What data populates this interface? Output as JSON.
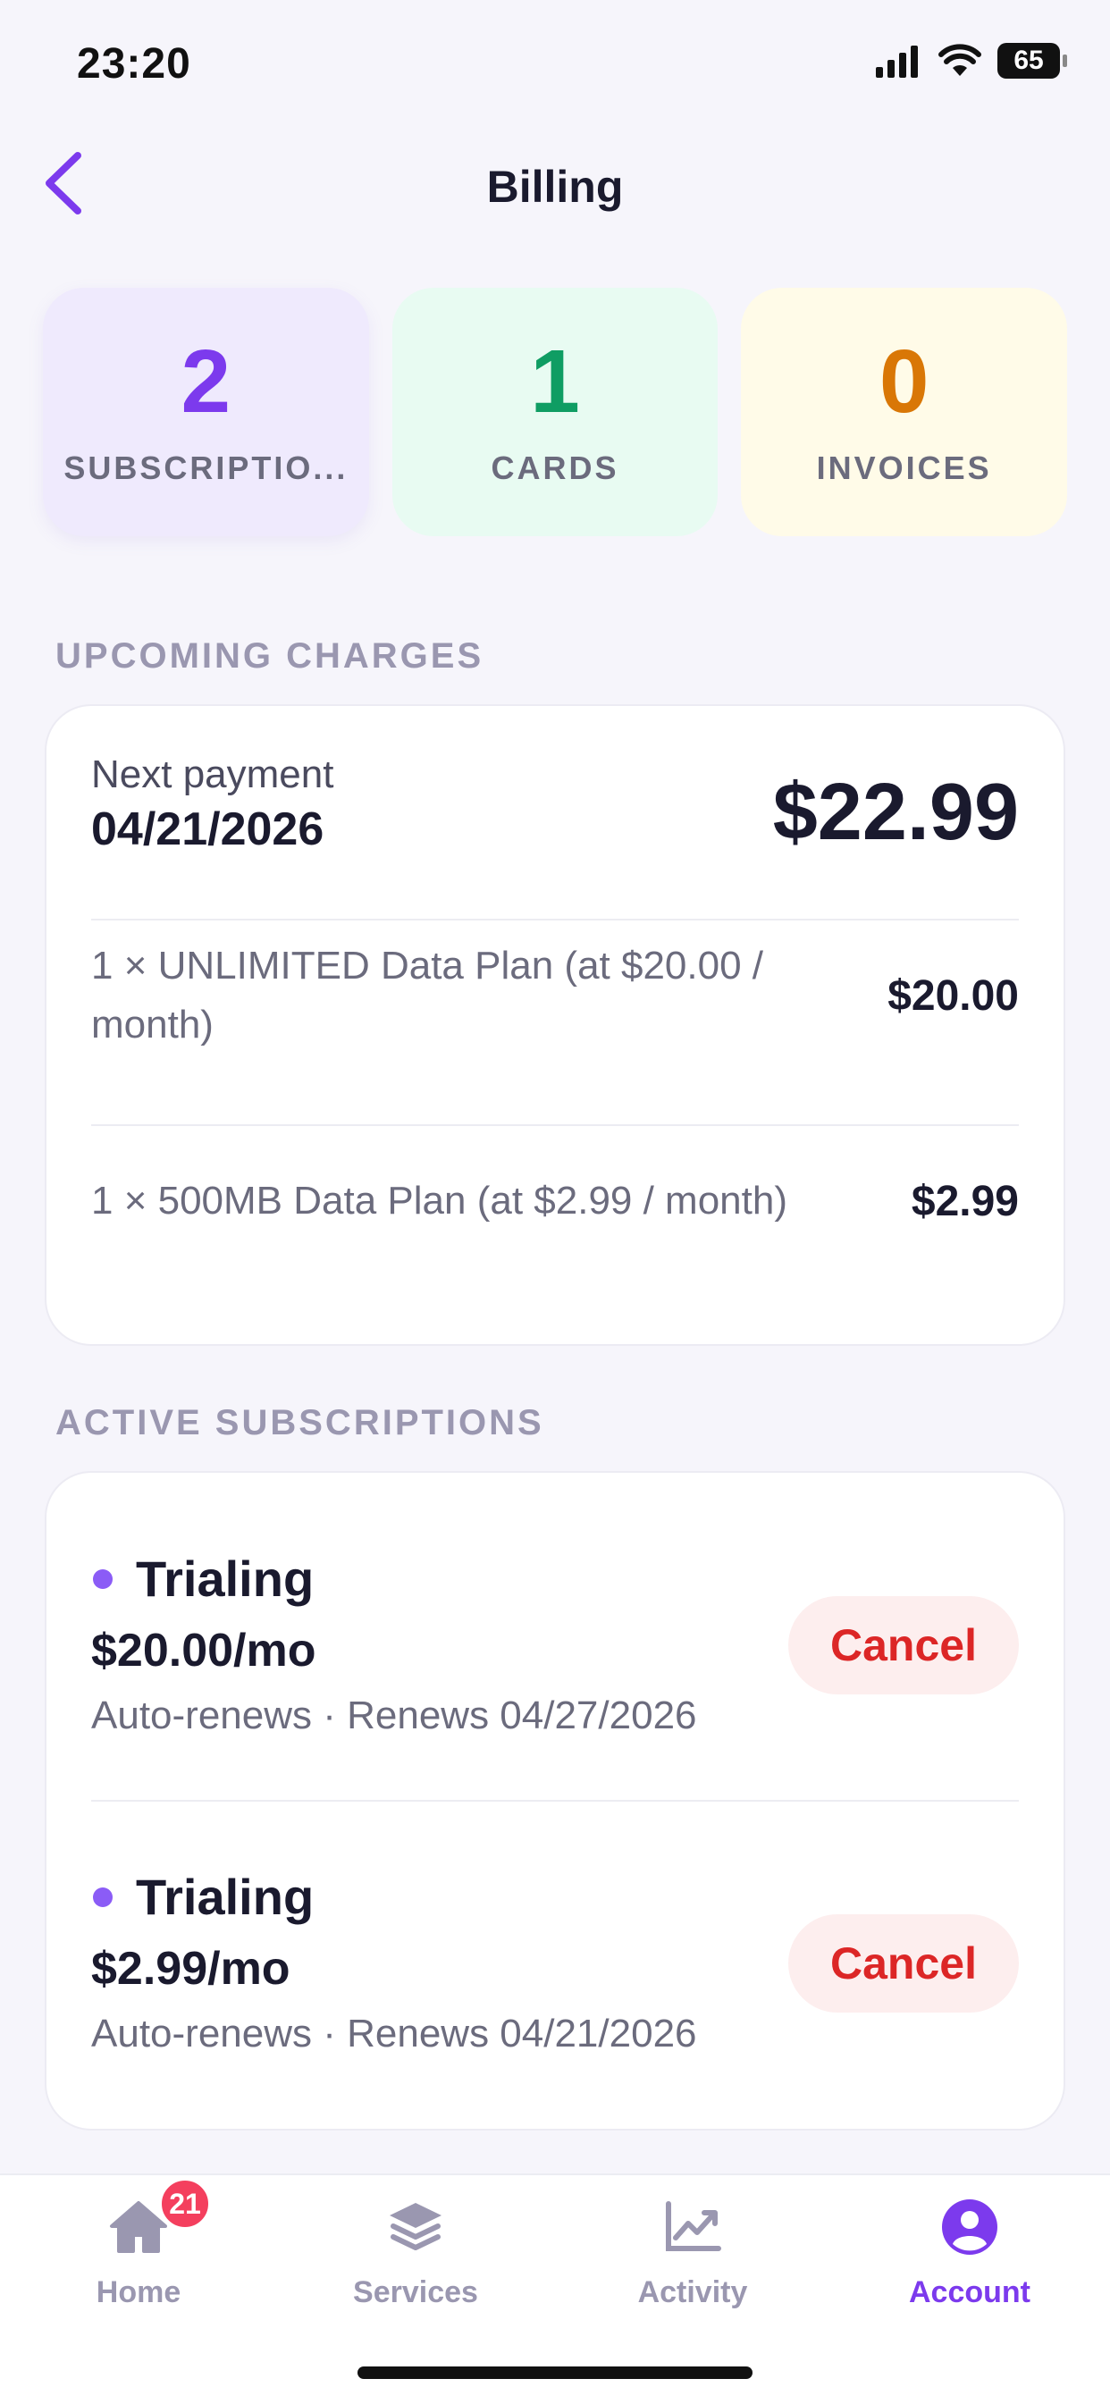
{
  "status_bar": {
    "time": "23:20",
    "battery": "65"
  },
  "header": {
    "title": "Billing"
  },
  "stats": [
    {
      "value": "2",
      "label": "SUBSCRIPTIO...",
      "color": "#7c3aed"
    },
    {
      "value": "1",
      "label": "CARDS",
      "color": "#0f9d63"
    },
    {
      "value": "0",
      "label": "INVOICES",
      "color": "#d97706"
    }
  ],
  "upcoming": {
    "section_label": "UPCOMING CHARGES",
    "next_label": "Next payment",
    "next_date": "04/21/2026",
    "total": "$22.99",
    "items": [
      {
        "desc": "1 × UNLIMITED Data Plan (at $20.00 / month)",
        "amount": "$20.00"
      },
      {
        "desc": "1 × 500MB Data Plan (at $2.99 / month)",
        "amount": "$2.99"
      }
    ]
  },
  "subscriptions": {
    "section_label": "ACTIVE SUBSCRIPTIONS",
    "items": [
      {
        "status": "Trialing",
        "price": "$20.00/mo",
        "meta": "Auto-renews · Renews 04/27/2026",
        "action": "Cancel"
      },
      {
        "status": "Trialing",
        "price": "$2.99/mo",
        "meta": "Auto-renews · Renews 04/21/2026",
        "action": "Cancel"
      }
    ]
  },
  "tabbar": {
    "items": [
      {
        "label": "Home",
        "icon": "home-icon",
        "badge": "21"
      },
      {
        "label": "Services",
        "icon": "layers-icon"
      },
      {
        "label": "Activity",
        "icon": "chart-icon"
      },
      {
        "label": "Account",
        "icon": "account-icon",
        "active": true
      }
    ]
  },
  "colors": {
    "accent": "#7c3aed",
    "danger": "#dc2626",
    "background": "#f6f5fb"
  }
}
